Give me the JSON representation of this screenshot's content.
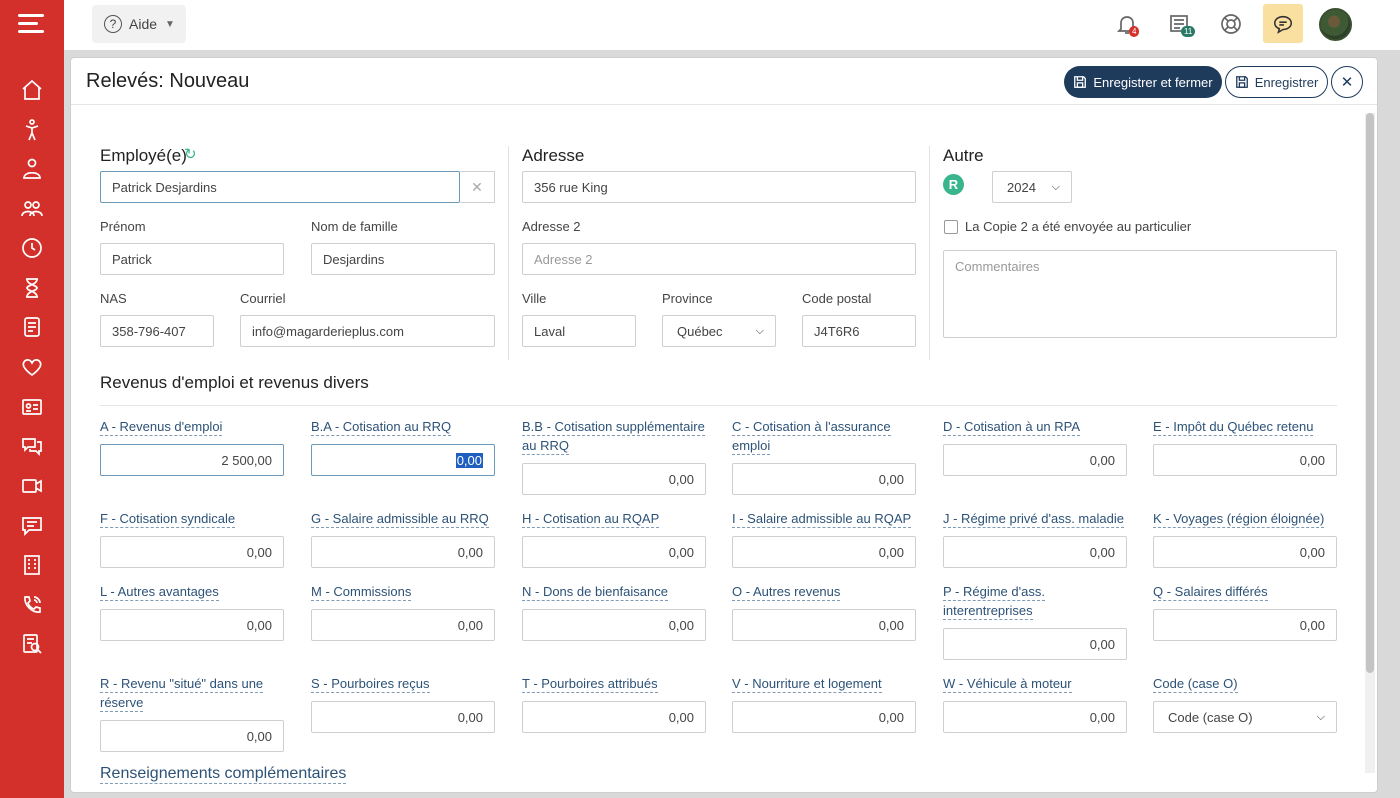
{
  "topbar": {
    "help_label": "Aide",
    "notifications_count": "4",
    "timesheet_count": "11"
  },
  "dialog": {
    "title": "Relevés: Nouveau",
    "save_close_label": "Enregistrer et fermer",
    "save_label": "Enregistrer"
  },
  "employee": {
    "section_title": "Employé(e)",
    "employee_value": "Patrick Desjardins",
    "first_name_label": "Prénom",
    "first_name": "Patrick",
    "last_name_label": "Nom de famille",
    "last_name": "Desjardins",
    "nas_label": "NAS",
    "nas": "358-796-407",
    "email_label": "Courriel",
    "email": "info@magarderieplus.com"
  },
  "address": {
    "section_title": "Adresse",
    "address1": "356 rue King",
    "address2_label": "Adresse 2",
    "address2_placeholder": "Adresse 2",
    "city_label": "Ville",
    "city": "Laval",
    "province_label": "Province",
    "province": "Québec",
    "postal_label": "Code postal",
    "postal": "J4T6R6"
  },
  "other": {
    "section_title": "Autre",
    "r_letter": "R",
    "year": "2024",
    "copy2_label": "La Copie 2 a été envoyée au particulier",
    "comments_placeholder": "Commentaires"
  },
  "income": {
    "section_title": "Revenus d'emploi et revenus divers",
    "A_label": "A - Revenus d'emploi",
    "A": "2 500,00",
    "BA_label": "B.A - Cotisation au RRQ",
    "BA": "0,00",
    "BB_label1": "B.B - Cotisation supplémentaire",
    "BB_label2": "au RRQ",
    "BB": "0,00",
    "C_label1": "C - Cotisation à l'assurance",
    "C_label2": "emploi",
    "C": "0,00",
    "D_label": "D - Cotisation à un RPA",
    "D": "0,00",
    "E_label": "E - Impôt du Québec retenu",
    "E": "0,00",
    "F_label": "F - Cotisation syndicale",
    "F": "0,00",
    "G_label": "G - Salaire admissible au RRQ",
    "G": "0,00",
    "H_label": "H - Cotisation au RQAP",
    "H": "0,00",
    "I_label": "I - Salaire admissible au RQAP",
    "I": "0,00",
    "J_label": "J - Régime privé d'ass. maladie",
    "J": "0,00",
    "K_label": "K - Voyages (région éloignée)",
    "K": "0,00",
    "L_label": "L - Autres avantages",
    "L": "0,00",
    "M_label": "M - Commissions",
    "M": "0,00",
    "N_label": "N - Dons de bienfaisance",
    "N": "0,00",
    "O_label": "O - Autres revenus",
    "O": "0,00",
    "P_label1": "P - Régime d'ass.",
    "P_label2": "interentreprises",
    "P": "0,00",
    "Q_label": "Q - Salaires différés",
    "Q": "0,00",
    "R_label1": "R - Revenu \"situé\" dans une",
    "R_label2": "réserve",
    "R": "0,00",
    "S_label": "S - Pourboires reçus",
    "S": "0,00",
    "T_label": "T - Pourboires attribués",
    "T": "0,00",
    "V_label": "V - Nourriture et logement",
    "V": "0,00",
    "W_label": "W - Véhicule à moteur",
    "W": "0,00",
    "codeO_label": "Code (case O)",
    "codeO": "Code (case O)"
  },
  "more_info_label": "Renseignements complémentaires"
}
